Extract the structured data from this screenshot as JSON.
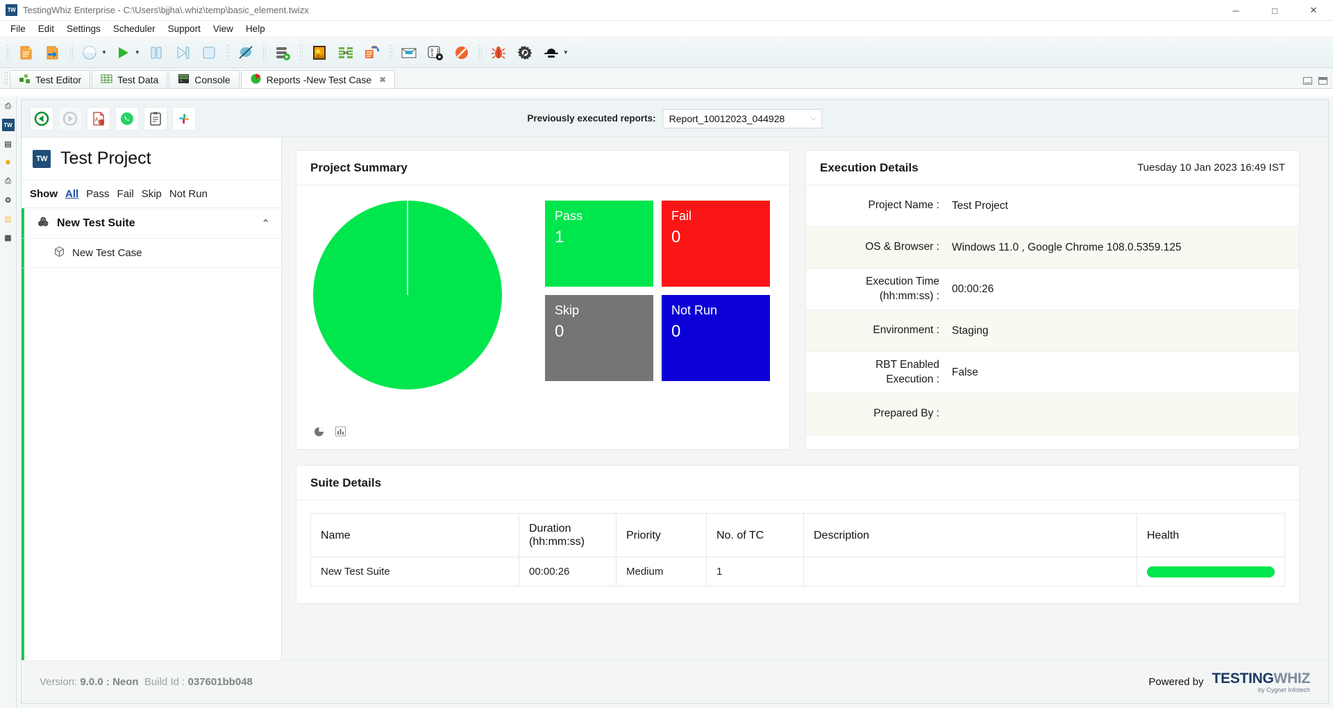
{
  "window": {
    "title": "TestingWhiz Enterprise - C:\\Users\\bjjha\\.whiz\\temp\\basic_element.twizx",
    "app_badge": "TW",
    "minimize": "─",
    "maximize": "□",
    "close": "✕"
  },
  "menu": {
    "items": [
      "File",
      "Edit",
      "Settings",
      "Scheduler",
      "Support",
      "View",
      "Help"
    ]
  },
  "toolbar": {
    "buttons": [
      {
        "name": "new-test-case-icon",
        "title": "New"
      },
      {
        "name": "import-test-case-icon",
        "title": "Import"
      },
      {
        "name": "record-icon",
        "title": "Record"
      },
      {
        "name": "run-icon",
        "title": "Run"
      },
      {
        "name": "pause-icon",
        "title": "Pause"
      },
      {
        "name": "step-icon",
        "title": "Step"
      },
      {
        "name": "stop-icon",
        "title": "Stop"
      },
      {
        "name": "no-proxy-icon",
        "title": "Object Repository"
      },
      {
        "name": "database-icon",
        "title": "Data Source"
      },
      {
        "name": "image-compare-icon",
        "title": "Visual Test"
      },
      {
        "name": "data-grid-icon",
        "title": "Test Data"
      },
      {
        "name": "data-exchange-icon",
        "title": "Data Exchange"
      },
      {
        "name": "mail-icon",
        "title": "Mail"
      },
      {
        "name": "binary-settings-icon",
        "title": "Configuration"
      },
      {
        "name": "restricted-icon",
        "title": "Blocked"
      },
      {
        "name": "bug-icon",
        "title": "Defect"
      },
      {
        "name": "gear-wrench-icon",
        "title": "Preferences"
      },
      {
        "name": "user-icon",
        "title": "User"
      }
    ]
  },
  "tabs": {
    "items": [
      {
        "label": "Test Editor",
        "icon": "test-editor-icon",
        "active": false,
        "closable": false
      },
      {
        "label": "Test Data",
        "icon": "test-data-icon",
        "active": false,
        "closable": false
      },
      {
        "label": "Console",
        "icon": "console-icon",
        "active": false,
        "closable": false
      },
      {
        "label": "Reports  -New Test Case",
        "icon": "reports-icon",
        "active": true,
        "closable": true
      }
    ],
    "close_glyph": "✖",
    "restore_title": "Restore",
    "maximize_title": "Maximize"
  },
  "rail": {
    "items": [
      {
        "name": "perspective-icon",
        "glyph": "⎙",
        "selected": false
      },
      {
        "name": "testingwhiz-perspective-icon",
        "glyph": "TW",
        "selected": true
      },
      {
        "name": "package-explorer-icon",
        "glyph": "▤",
        "selected": false
      },
      {
        "name": "folder-icon",
        "glyph": "■",
        "selected": false
      },
      {
        "name": "outline-icon",
        "glyph": "⎙",
        "selected": false
      },
      {
        "name": "settings-gear-icon",
        "glyph": "⚙",
        "selected": false
      },
      {
        "name": "notes-icon",
        "glyph": "▧",
        "selected": false
      },
      {
        "name": "reports-panel-icon",
        "glyph": "▦",
        "selected": false
      }
    ]
  },
  "report_toolbar": {
    "buttons": [
      {
        "name": "back-button",
        "icon": "back-arrow-icon",
        "disabled": false
      },
      {
        "name": "forward-button",
        "icon": "forward-arrow-icon",
        "disabled": true
      },
      {
        "name": "export-pdf-button",
        "icon": "pdf-icon",
        "disabled": false
      },
      {
        "name": "share-whatsapp-button",
        "icon": "whatsapp-icon",
        "disabled": false
      },
      {
        "name": "view-log-button",
        "icon": "clipboard-icon",
        "disabled": false
      },
      {
        "name": "share-slack-button",
        "icon": "slack-icon",
        "disabled": false
      }
    ],
    "select_label": "Previously executed reports:",
    "selected_report": "Report_10012023_044928",
    "chevron": "⌵"
  },
  "project_panel": {
    "logo": "TW",
    "project_name": "Test Project",
    "show_label": "Show",
    "filters": [
      "All",
      "Pass",
      "Fail",
      "Skip",
      "Not Run"
    ],
    "active_filter": "All",
    "suite": {
      "label": "New Test Suite",
      "icon": "suite-icon",
      "collapse_glyph": "⌃"
    },
    "cases": [
      {
        "label": "New Test Case",
        "icon": "test-case-icon"
      }
    ]
  },
  "summary": {
    "title": "Project Summary",
    "tiles": [
      {
        "label": "Pass",
        "value": "1",
        "color": "#00e64d"
      },
      {
        "label": "Fail",
        "value": "0",
        "color": "#fa1616"
      },
      {
        "label": "Skip",
        "value": "0",
        "color": "#757575"
      },
      {
        "label": "Not Run",
        "value": "0",
        "color": "#0b00d6"
      }
    ],
    "toggles": [
      {
        "name": "pie-chart-toggle",
        "glyph": "◔"
      },
      {
        "name": "bar-chart-toggle",
        "glyph": "▐"
      }
    ]
  },
  "chart_data": {
    "type": "pie",
    "title": "Project Summary",
    "categories": [
      "Pass",
      "Fail",
      "Skip",
      "Not Run"
    ],
    "values": [
      1,
      0,
      0,
      0
    ],
    "colors": [
      "#00e64d",
      "#fa1616",
      "#757575",
      "#0b00d6"
    ],
    "total": 1,
    "legend": "tiles",
    "xlabel": "",
    "ylabel": ""
  },
  "execution": {
    "title": "Execution Details",
    "date": "Tuesday 10 Jan 2023 16:49 IST",
    "rows": [
      {
        "key": "Project Name :",
        "value": "Test Project"
      },
      {
        "key": "OS & Browser :",
        "value": "Windows 11.0 , Google Chrome 108.0.5359.125"
      },
      {
        "key": "Execution Time (hh:mm:ss) :",
        "value": "00:00:26"
      },
      {
        "key": "Environment :",
        "value": "Staging"
      },
      {
        "key": "RBT Enabled Execution :",
        "value": "False"
      },
      {
        "key": "Prepared By :",
        "value": ""
      }
    ]
  },
  "suite_details": {
    "title": "Suite Details",
    "columns": [
      "Name",
      "Duration (hh:mm:ss)",
      "Priority",
      "No. of TC",
      "Description",
      "Health"
    ],
    "rows": [
      {
        "name": "New Test Suite",
        "duration": "00:00:26",
        "priority": "Medium",
        "tc_count": "1",
        "description": "",
        "health_color": "#00e64d",
        "health_percent": 100
      }
    ]
  },
  "footer": {
    "version_prefix": "Version:",
    "version": "9.0.0 : Neon",
    "build_label": "Build Id :",
    "build_id": "037601bb048",
    "powered_by": "Powered by",
    "brand_first": "TESTING",
    "brand_second": "WHIZ",
    "brand_sub": "by Cygnet Infotech"
  }
}
